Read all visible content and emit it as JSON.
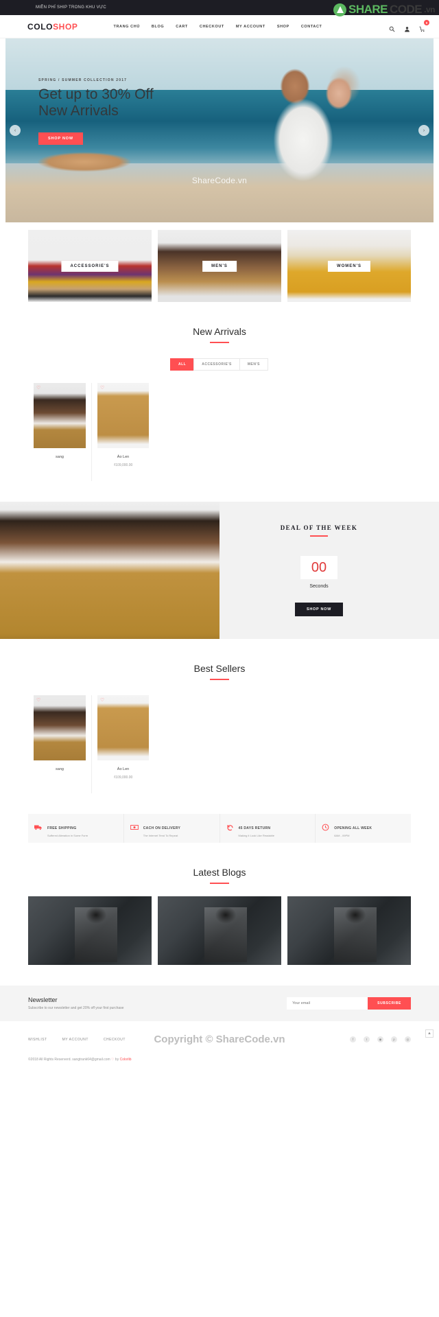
{
  "topbar": {
    "promo": "MIỄN PHÍ SHIP TRONG KHU VỰC"
  },
  "watermark": {
    "share": "SHARE",
    "code": "CODE",
    "vn": ".vn",
    "hero": "ShareCode.vn",
    "footer": "Copyright © ShareCode.vn"
  },
  "header": {
    "logo_first": "COLO",
    "logo_second": "SHOP",
    "nav": [
      {
        "label": "TRANG CHỦ"
      },
      {
        "label": "BLOG"
      },
      {
        "label": "CART"
      },
      {
        "label": "CHECKOUT"
      },
      {
        "label": "MY ACCOUNT"
      },
      {
        "label": "SHOP"
      },
      {
        "label": "CONTACT"
      }
    ],
    "search_icon": "search-icon",
    "account_icon": "user-icon",
    "cart_icon": "cart-icon",
    "cart_count": "0"
  },
  "hero": {
    "kicker": "SPRING / SUMMER COLLECTION 2017",
    "title_line1": "Get up to 30% Off",
    "title_line2": "New Arrivals",
    "cta": "SHOP NOW",
    "prev": "‹",
    "next": "›"
  },
  "categories": [
    {
      "label": "ACCESSORIE'S"
    },
    {
      "label": "MEN'S"
    },
    {
      "label": "WOMEN'S"
    }
  ],
  "new_arrivals": {
    "title": "New Arrivals",
    "filters": [
      {
        "label": "ALL",
        "active": true
      },
      {
        "label": "ACCESSORIE'S",
        "active": false
      },
      {
        "label": "MEN'S",
        "active": false
      }
    ],
    "products": [
      {
        "name": "sang",
        "price": ""
      },
      {
        "name": "Áo Len",
        "price": "₫109,000.00"
      }
    ]
  },
  "deal": {
    "title": "DEAL OF THE WEEK",
    "count": "00",
    "unit": "Seconds",
    "cta": "SHOP NOW"
  },
  "best_sellers": {
    "title": "Best Sellers",
    "products": [
      {
        "name": "sang",
        "price": ""
      },
      {
        "name": "Áo Len",
        "price": "₫109,000.00"
      }
    ]
  },
  "services": [
    {
      "icon": "truck-icon",
      "glyph": "🚚",
      "title": "FREE SHIPPING",
      "subtitle": "Suffered Alteration in Some Form"
    },
    {
      "icon": "cash-icon",
      "glyph": "💵",
      "title": "CACH ON DELIVERY",
      "subtitle": "The Internet Tend To Repeat"
    },
    {
      "icon": "return-icon",
      "glyph": "↺",
      "title": "45 DAYS RETURN",
      "subtitle": "Making it Look Like Readable"
    },
    {
      "icon": "clock-icon",
      "glyph": "◷",
      "title": "OPENING ALL WEEK",
      "subtitle": "8AM - 09PM"
    }
  ],
  "blogs": {
    "title": "Latest Blogs",
    "posts": [
      {},
      {},
      {}
    ]
  },
  "newsletter": {
    "title": "Newsletter",
    "subtitle": "Subscribe to our newsletter and get 20% off your first purchase",
    "placeholder": "Your email",
    "value": "",
    "button": "SUBSCRIBE"
  },
  "footer": {
    "links": [
      {
        "label": "WISHLIST"
      },
      {
        "label": "MY ACCOUNT"
      },
      {
        "label": "CHECKOUT"
      }
    ],
    "social": [
      {
        "name": "facebook-icon",
        "glyph": "f"
      },
      {
        "name": "twitter-icon",
        "glyph": "t"
      },
      {
        "name": "instagram-icon",
        "glyph": "◉"
      },
      {
        "name": "pinterest-icon",
        "glyph": "p"
      },
      {
        "name": "dribbble-icon",
        "glyph": "◎"
      }
    ],
    "copyright_pre": "©2018 All Rights Reserverd. sangtrank64@gmail.com ",
    "copyright_heart": "♡",
    "copyright_mid": " by ",
    "copyright_brand": "Colorlib",
    "to_top": "▲"
  },
  "colors": {
    "accent": "#ff4f52",
    "dark": "#1d1d24",
    "muted": "#9a9a9a"
  }
}
